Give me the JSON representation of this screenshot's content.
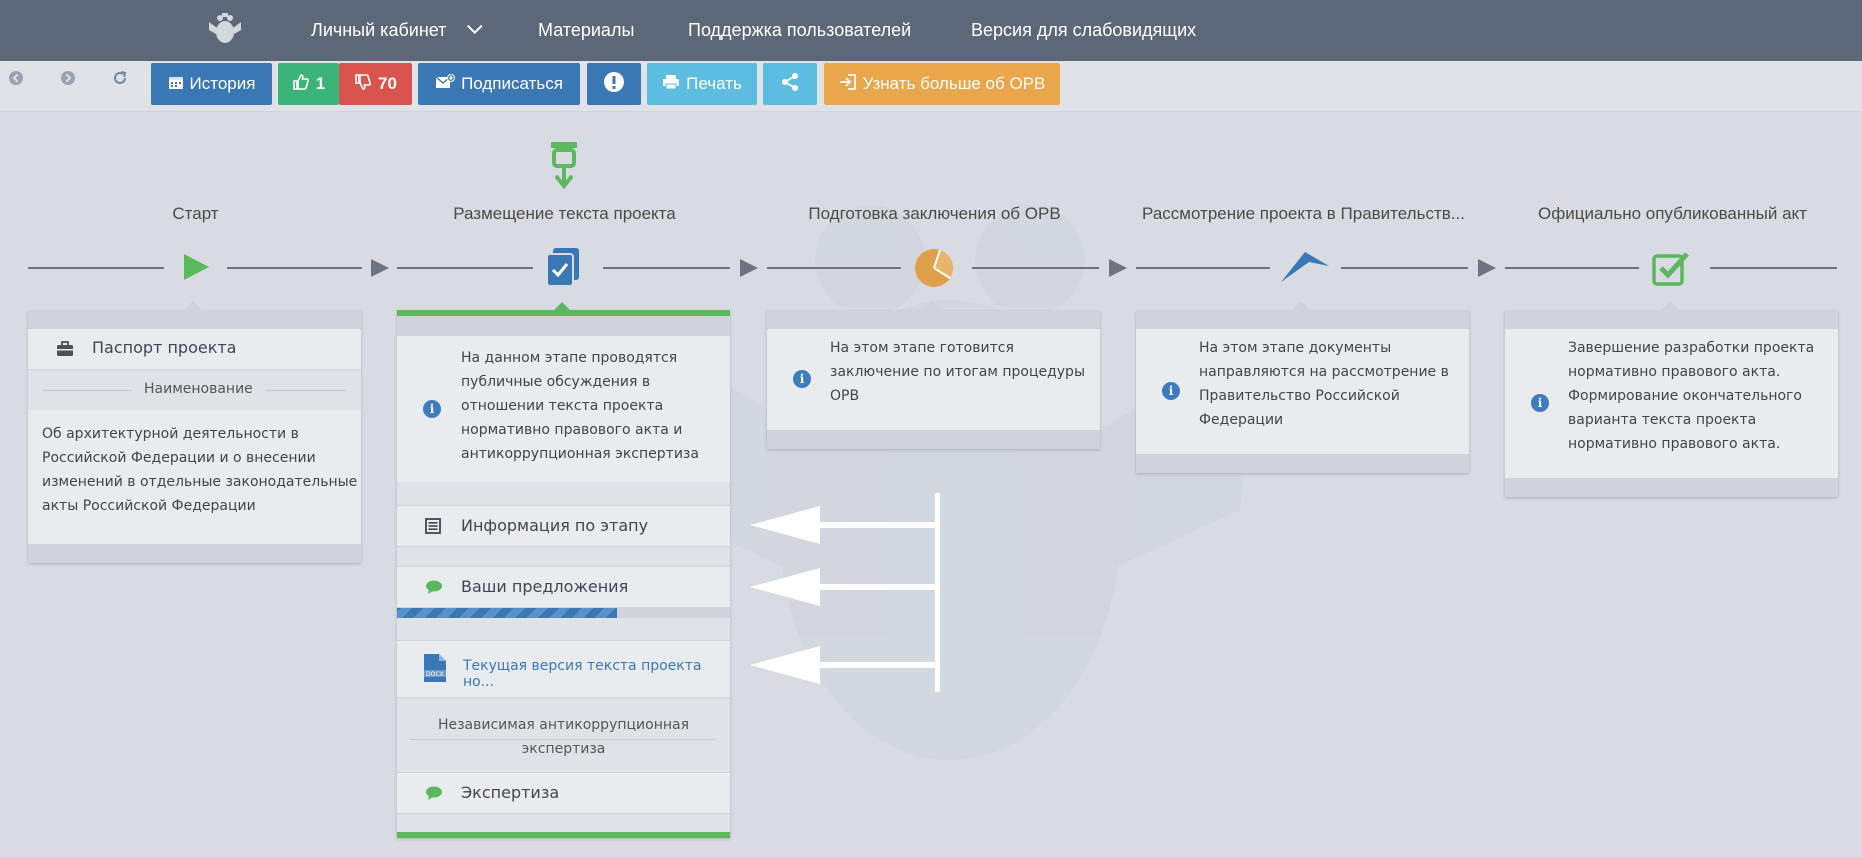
{
  "nav": {
    "emblem": "eagle-emblem",
    "items": [
      {
        "label": "Личный кабинет",
        "has_dropdown": true
      },
      {
        "label": "Материалы"
      },
      {
        "label": "Поддержка пользователей"
      },
      {
        "label": "Версия для слабовидящих"
      }
    ]
  },
  "toolbar": {
    "history_label": "История",
    "likes": "1",
    "dislikes": "70",
    "subscribe_label": "Подписаться",
    "print_label": "Печать",
    "learn_more_label": "Узнать больше об ОРВ",
    "colors": {
      "history": "#3a78b5",
      "likes": "#3bb47a",
      "dislikes": "#d9534f",
      "subscribe": "#3a78b5",
      "alert": "#3a78b5",
      "print": "#5dbde0",
      "share": "#5dbde0",
      "learn_more": "#eaa64a"
    }
  },
  "stages": [
    {
      "title": "Старт",
      "icon": "play-icon",
      "color": "#5cb85c"
    },
    {
      "title": "Размещение текста проекта",
      "icon": "document-check-icon",
      "color": "#3a78b5",
      "current": true
    },
    {
      "title": "Подготовка заключения об ОРВ",
      "icon": "pie-chart-icon",
      "color": "#e0a04a"
    },
    {
      "title": "Рассмотрение проекта в Правительств...",
      "icon": "chevron-up-icon",
      "color": "#3a78b5"
    },
    {
      "title": "Официально опубликованный акт",
      "icon": "checkbox-icon",
      "color": "#5cb85c"
    }
  ],
  "card1": {
    "heading": "Паспорт проекта",
    "separator": "Наименование",
    "text": [
      "Об архитектурной деятельности в",
      "Российской Федерации и о внесении",
      "изменений в отдельные законодательные",
      "акты Российской Федерации"
    ]
  },
  "card2": {
    "info": [
      "На данном этапе проводятся",
      "публичные обсуждения в",
      "отношении текста проекта",
      "нормативно правового акта и",
      "антикоррупционная экспертиза"
    ],
    "stage_info_label": "Информация по этапу",
    "proposals_label": "Ваши предложения",
    "proposals_progress": 0.66,
    "doc_link": "Текущая версия текста проекта но...",
    "expertise_separator": [
      "Независимая антикоррупционная",
      "экспертиза"
    ],
    "expertise_label": "Экспертиза"
  },
  "card3": {
    "info": [
      "На этом этапе готовится",
      "заключение по итогам процедуры",
      "ОРВ"
    ]
  },
  "card4": {
    "info": [
      "На этом этапе документы",
      "направляются на рассмотрение в",
      "Правительство Российской",
      "Федерации"
    ]
  },
  "card5": {
    "info": [
      "Завершение разработки проекта",
      "нормативно правового акта.",
      "Формирование окончательного",
      "варианта текста проекта",
      "нормативно правового акта."
    ]
  }
}
